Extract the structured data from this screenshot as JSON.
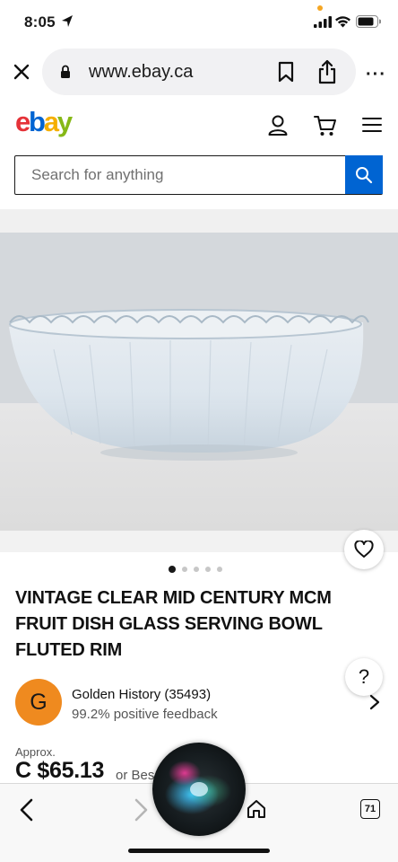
{
  "status_bar": {
    "time": "8:05",
    "icons": [
      "location-arrow-icon",
      "signal-icon",
      "wifi-icon",
      "battery-icon"
    ]
  },
  "browser": {
    "url": "www.ebay.ca",
    "icons": [
      "close-icon",
      "lock-icon",
      "bookmark-icon",
      "share-icon",
      "more-icon"
    ],
    "more_label": "···"
  },
  "ebay": {
    "logo": {
      "e": "e",
      "b": "b",
      "a": "a",
      "y": "y"
    },
    "logo_colors": [
      "#e53238",
      "#0064d2",
      "#f5af02",
      "#86b817"
    ],
    "search_placeholder": "Search for anything",
    "accent": "#0064d2"
  },
  "product": {
    "image_dots": {
      "total": 5,
      "active": 1
    },
    "title": "VINTAGE CLEAR MID CENTURY MCM FRUIT DISH GLASS SERVING BOWL FLUTED RIM",
    "help_label": "?",
    "seller": {
      "initial": "G",
      "name": "Golden History (35493)",
      "feedback": "99.2% positive feedback",
      "avatar_color": "#ef8a1f"
    },
    "price_prefix": "Approx.",
    "price": "C $65.13",
    "offer_text": "or Bes"
  },
  "toolbar": {
    "tabs_count": "71",
    "icons": [
      "back-icon",
      "forward-icon",
      "home-icon",
      "tabs-icon"
    ]
  }
}
